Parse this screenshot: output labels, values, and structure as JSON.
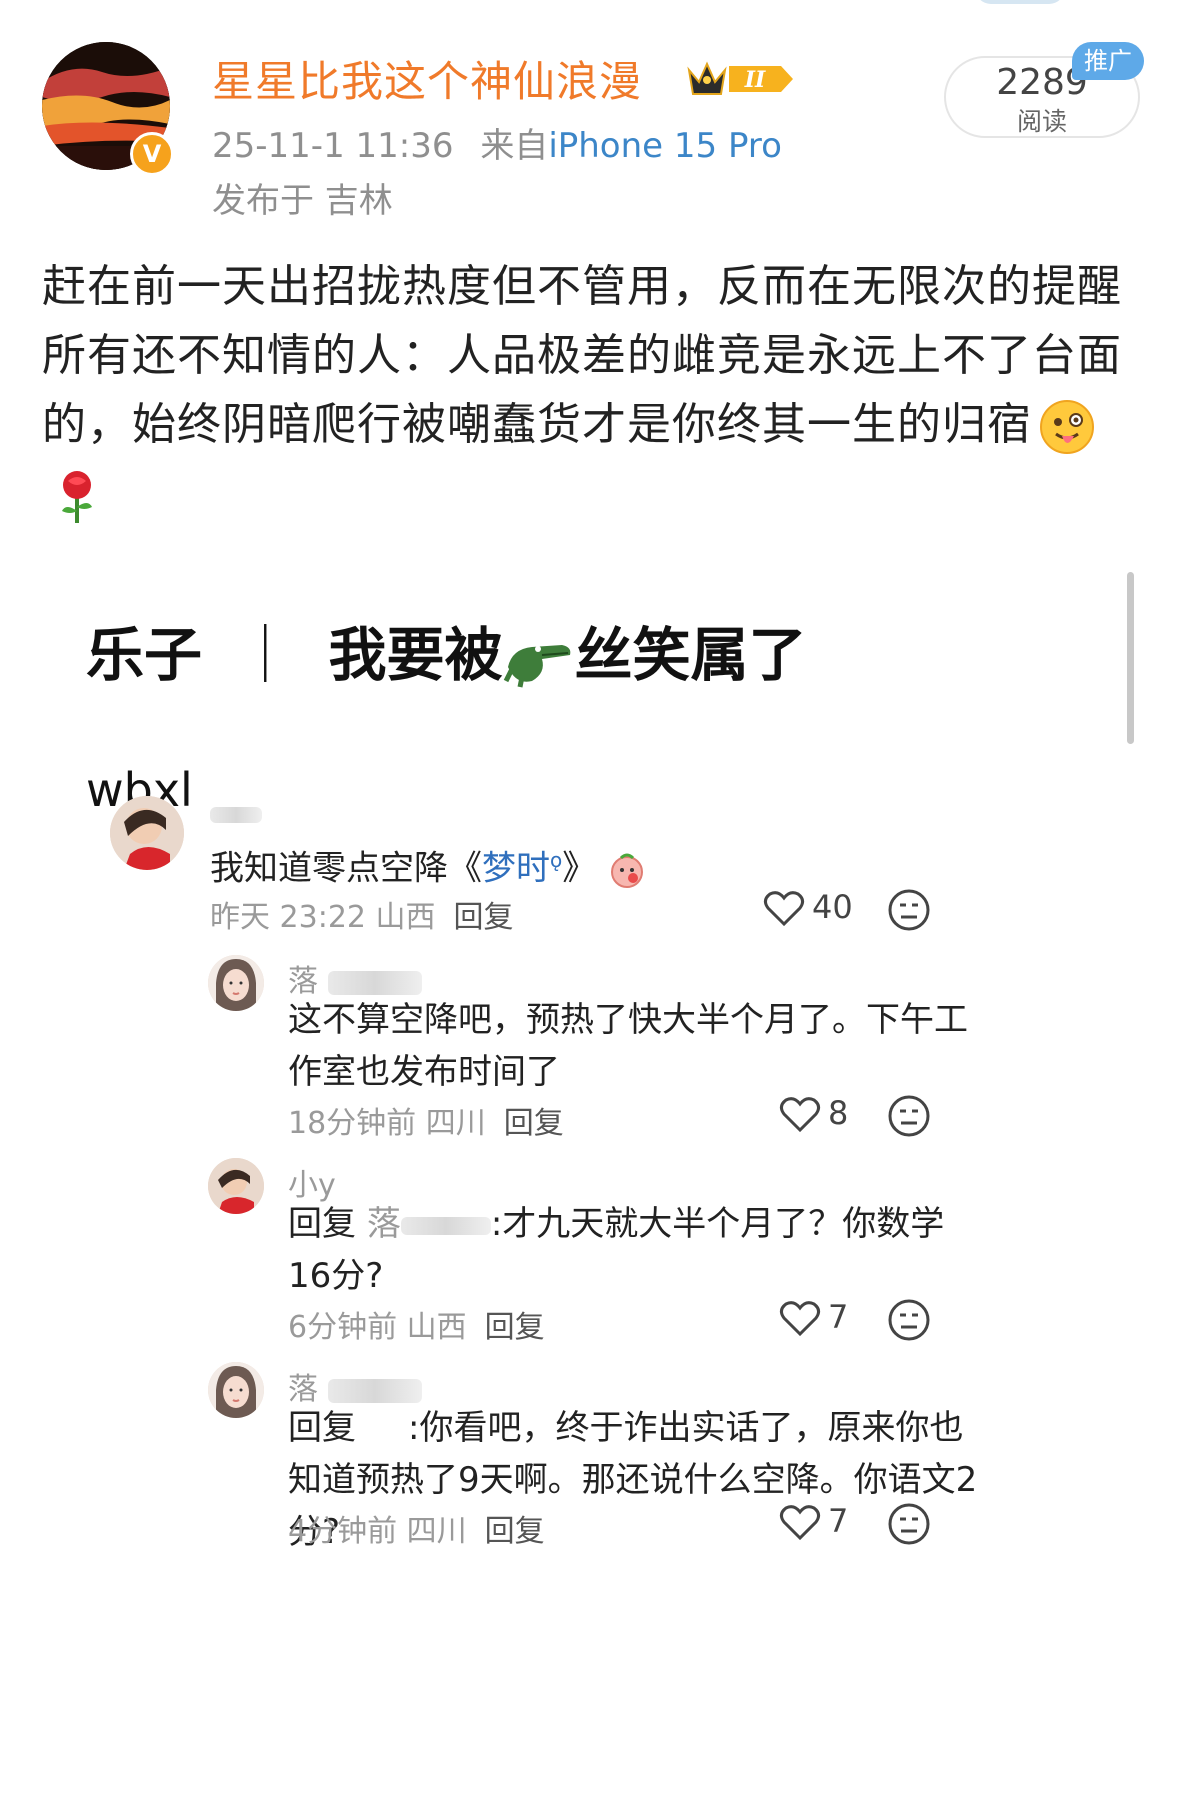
{
  "post": {
    "username": "星星比我这个神仙浪漫",
    "level": "II",
    "datetime": "25-11-1 11:36",
    "source_prefix": "来自",
    "device": "iPhone 15 Pro",
    "location": "发布于 吉林",
    "read_count": "2289",
    "read_label": "阅读",
    "ad_tag": "推广",
    "text": "赶在前一天出招拢热度但不管用，反而在无限次的提醒所有还不知情的人：人品极差的雌竞是永远上不了台面的，始终阴暗爬行被嘲蠢货才是你终其一生的归宿"
  },
  "screenshot": {
    "title_left": "乐子",
    "title_sep": "｜",
    "title_mid": "我要被",
    "title_right": "丝笑属了",
    "subtitle": "wbxl",
    "comments": [
      {
        "name": "",
        "text_before": "我知道零点空降《",
        "text_link": "梦时",
        "text_after": "》",
        "time": "昨天 23:22 山西",
        "reply_label": "回复",
        "likes": "40"
      },
      {
        "name": "落",
        "text": "这不算空降吧，预热了快大半个月了。下午工作室也发布时间了",
        "time": "18分钟前 四川",
        "reply_label": "回复",
        "likes": "8"
      },
      {
        "name": "小y",
        "text_prefix": "回复",
        "reply_to": "落",
        "text": ":才九天就大半个月了？你数学16分?",
        "time": "6分钟前 山西",
        "reply_label": "回复",
        "likes": "7"
      },
      {
        "name": "落",
        "text_prefix": "回复",
        "text": ":你看吧，终于诈出实话了，原来你也知道预热了9天啊。那还说什么空降。你语文2分?",
        "time": "4分钟前 四川",
        "reply_label": "回复",
        "likes": "7"
      }
    ]
  },
  "colors": {
    "username": "#f07a2a",
    "device_link": "#3c86c8",
    "ad_tag": "#5ea9e8",
    "verified_badge": "#f6a21c"
  },
  "icons": [
    "verified-badge-icon",
    "level-crown-icon",
    "tongue-emoji-icon",
    "rose-emoji-icon",
    "crocodile-emoji-icon",
    "heart-icon",
    "expressionless-face-icon",
    "search-icon"
  ]
}
